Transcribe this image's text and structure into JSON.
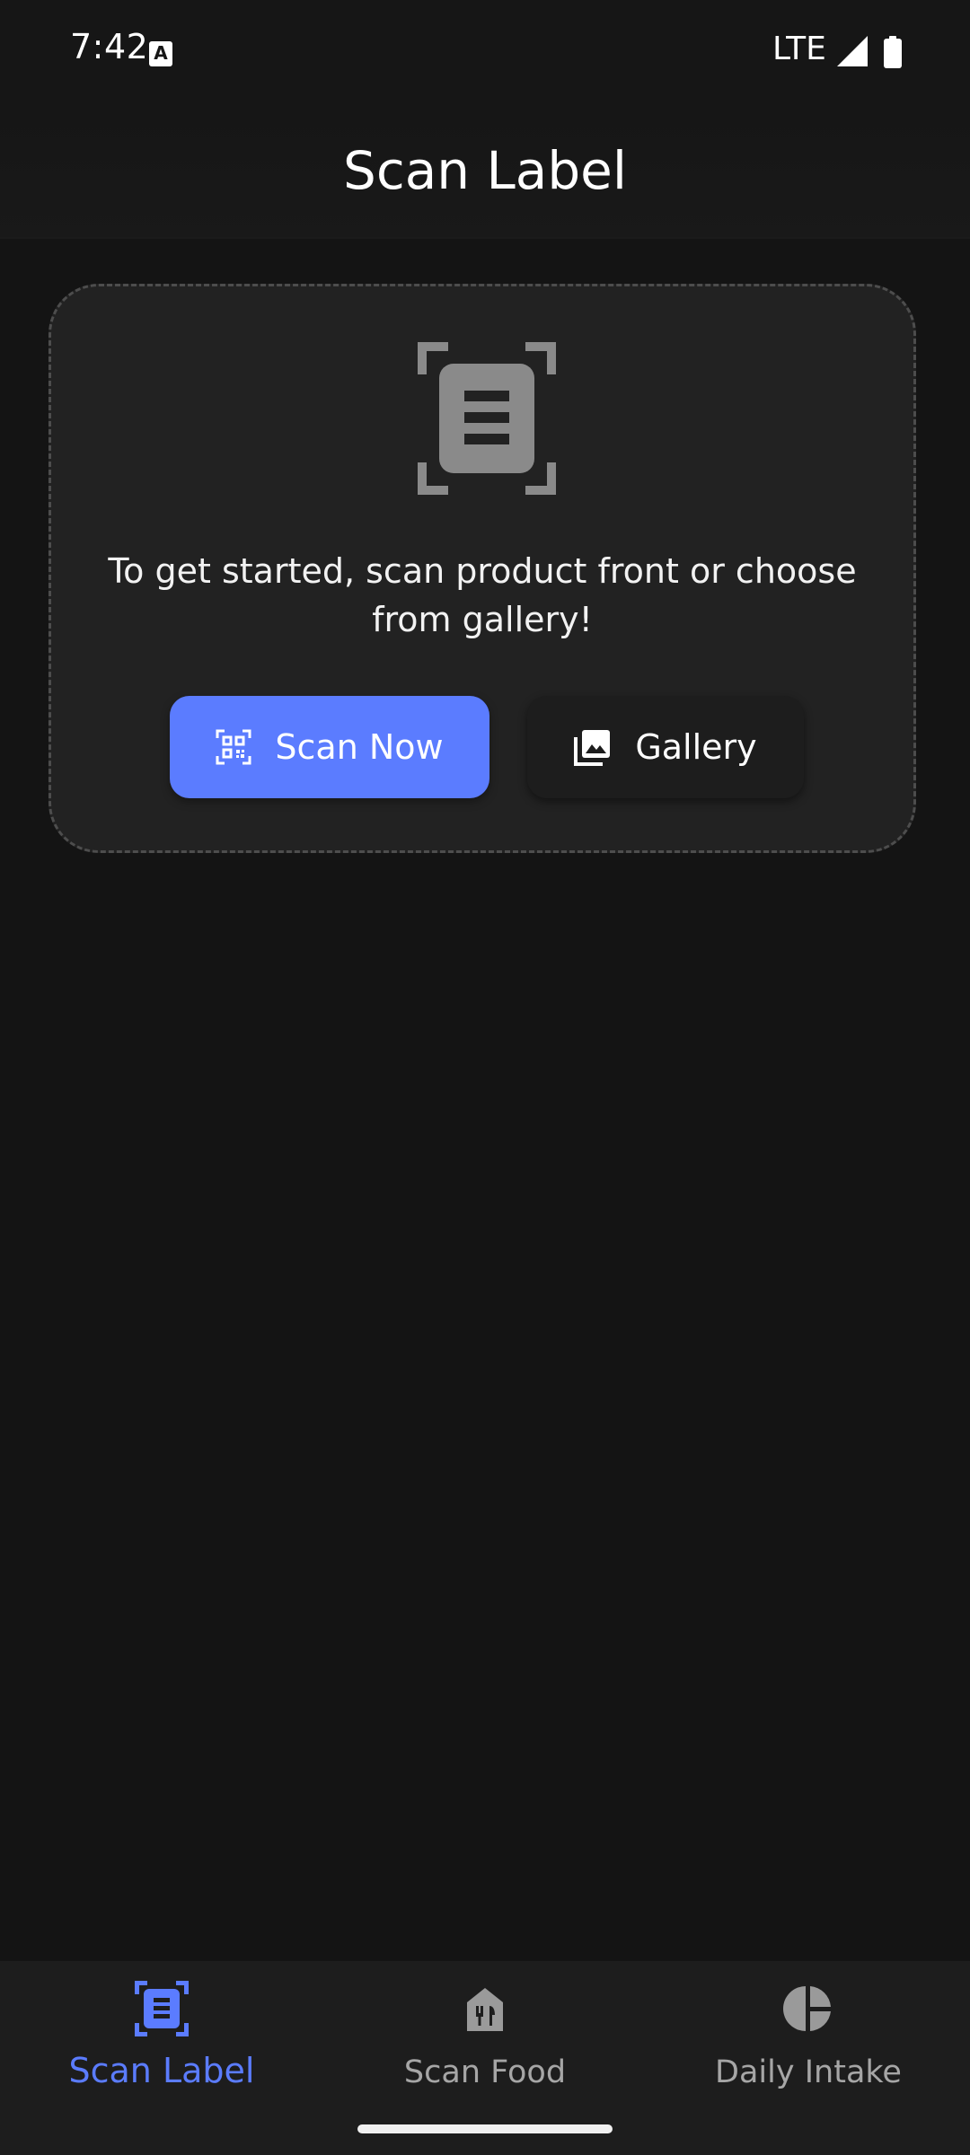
{
  "status_bar": {
    "time": "7:42",
    "notification_icon": "A",
    "network": "LTE",
    "icons": [
      "a-notification-icon",
      "signal-icon",
      "battery-icon"
    ]
  },
  "header": {
    "title": "Scan Label"
  },
  "card": {
    "icon": "scan-document-icon",
    "message": "To get started, scan product front or choose from gallery!",
    "scan_button_label": "Scan Now",
    "scan_button_icon": "qr-scan-icon",
    "gallery_button_label": "Gallery",
    "gallery_button_icon": "photo-library-icon"
  },
  "bottom_nav": {
    "items": [
      {
        "label": "Scan Label",
        "icon": "scan-label-icon",
        "active": true
      },
      {
        "label": "Scan Food",
        "icon": "restaurant-icon",
        "active": false
      },
      {
        "label": "Daily Intake",
        "icon": "pie-chart-icon",
        "active": false
      }
    ]
  },
  "colors": {
    "background": "#141414",
    "card": "#222222",
    "accent": "#5b7cff",
    "inactive": "#a6a6a6"
  }
}
